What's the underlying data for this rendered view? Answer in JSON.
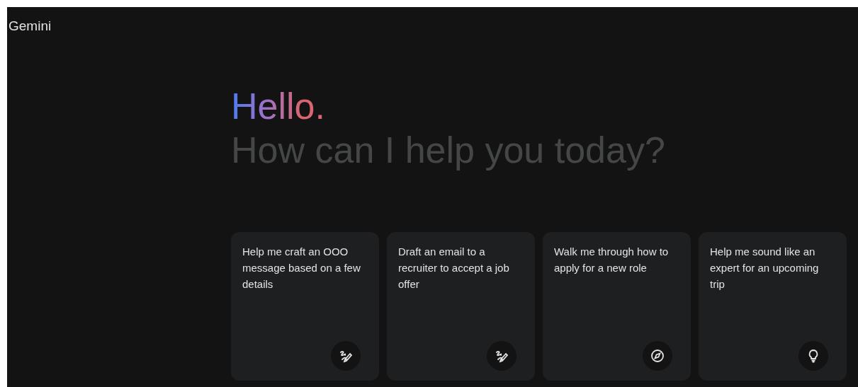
{
  "app": {
    "title": "Gemini"
  },
  "greeting": {
    "hello": "Hello.",
    "subtitle": "How can I help you today?"
  },
  "suggestions": [
    {
      "text": "Help me craft an OOO message based on a few details",
      "kind": "pen"
    },
    {
      "text": "Draft an email to a recruiter to accept a job offer",
      "kind": "pen"
    },
    {
      "text": "Walk me through how to apply for a new role",
      "kind": "compass"
    },
    {
      "text": "Help me sound like an expert for an upcoming trip",
      "kind": "bulb"
    }
  ]
}
